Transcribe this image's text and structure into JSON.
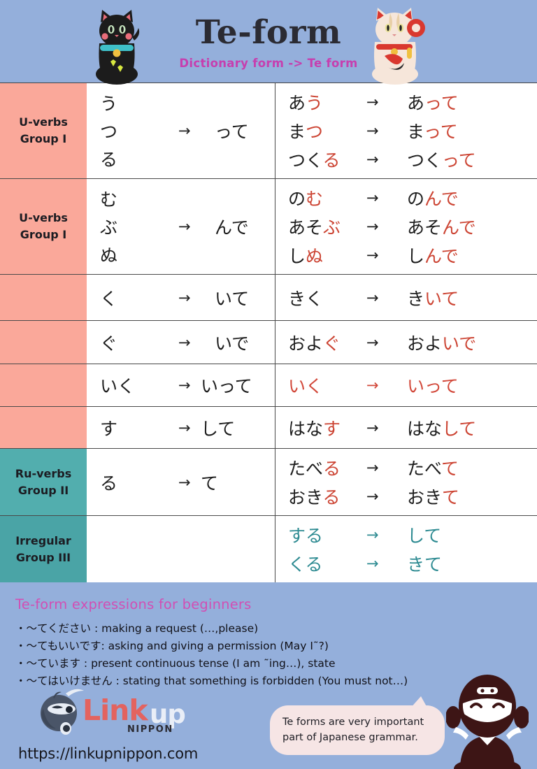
{
  "header": {
    "title": "Te-form",
    "subtitle": "Dictionary form  -> Te form",
    "cat_left": "black-maneki-neko",
    "cat_right": "white-maneki-neko"
  },
  "colors": {
    "background": "#94AFDB",
    "u_verbs_band": "#FAA89A",
    "ru_verbs_band": "#52AEAE",
    "irregular_band": "#4AA4A6",
    "highlight_red": "#CC4433",
    "irregular_teal": "#2E8B92",
    "title": "#2B2B33",
    "subtitle": "#C63FAF",
    "footer_heading": "#D14FB4"
  },
  "groups": {
    "u_verbs": {
      "line1": "U-verbs",
      "line2": "Group I"
    },
    "ru_verbs": {
      "line1": "Ru-verbs",
      "line2": "Group II"
    },
    "irregular": {
      "line1": "Irregular",
      "line2": "Group III"
    }
  },
  "arrow": "→",
  "rows": [
    {
      "rule": {
        "sources": [
          "う",
          "つ",
          "る"
        ],
        "arrow": "→",
        "result": "って"
      },
      "examples": [
        {
          "stem": "あ",
          "end": "う",
          "to": "あっ",
          "to_end": "って",
          "dict": "あう",
          "te": "あって"
        },
        {
          "stem": "ま",
          "end": "つ",
          "to": "まっ",
          "to_end": "って",
          "dict": "まつ",
          "te": "まって"
        },
        {
          "stem": "つく",
          "end": "る",
          "to": "つく",
          "to_end": "って",
          "dict": "つくる",
          "te": "つくって"
        }
      ]
    },
    {
      "rule": {
        "sources": [
          "む",
          "ぶ",
          "ぬ"
        ],
        "arrow": "→",
        "result": "んで"
      },
      "examples": [
        {
          "stem": "の",
          "end": "む",
          "to": "の",
          "to_end": "んで",
          "dict": "のむ",
          "te": "のんで"
        },
        {
          "stem": "あそ",
          "end": "ぶ",
          "to": "あそ",
          "to_end": "んで",
          "dict": "あそぶ",
          "te": "あそんで"
        },
        {
          "stem": "し",
          "end": "ぬ",
          "to": "し",
          "to_end": "んで",
          "dict": "しぬ",
          "te": "しんで"
        }
      ]
    },
    {
      "rule": {
        "sources": [
          "く"
        ],
        "arrow": "→",
        "result": "いて"
      },
      "examples": [
        {
          "stem": "き",
          "end": "く",
          "to": "き",
          "to_end": "いて",
          "dict": "きく",
          "te": "きいて"
        }
      ]
    },
    {
      "rule": {
        "sources": [
          "ぐ"
        ],
        "arrow": "→",
        "result": "いで"
      },
      "examples": [
        {
          "stem": "およ",
          "end": "ぐ",
          "to": "およ",
          "to_end": "いで",
          "dict": "およぐ",
          "te": "およいで"
        }
      ]
    },
    {
      "rule": {
        "sources": [
          "いく"
        ],
        "arrow": "→",
        "result": "いって"
      },
      "examples": [
        {
          "stem": "",
          "end": "いく",
          "to": "",
          "to_end": "いって",
          "dict": "いく",
          "te": "いって",
          "all_red": true
        }
      ]
    },
    {
      "rule": {
        "sources": [
          "す"
        ],
        "arrow": "→",
        "result": "して"
      },
      "examples": [
        {
          "stem": "はな",
          "end": "す",
          "to": "はな",
          "to_end": "して",
          "dict": "はなす",
          "te": "はなして"
        }
      ]
    }
  ],
  "ru_row": {
    "rule": {
      "sources": [
        "る"
      ],
      "arrow": "→",
      "result": "て"
    },
    "examples": [
      {
        "stem": "たべ",
        "end": "る",
        "to": "たべ",
        "to_end": "て",
        "dict": "たべる",
        "te": "たべて"
      },
      {
        "stem": "おき",
        "end": "る",
        "to": "おき",
        "to_end": "て",
        "dict": "おきる",
        "te": "おきて"
      }
    ]
  },
  "irregular_row": {
    "rule": {
      "sources": [],
      "arrow": "",
      "result": ""
    },
    "examples": [
      {
        "dict": "する",
        "te": "して"
      },
      {
        "dict": "くる",
        "te": "きて"
      }
    ]
  },
  "footer": {
    "heading": "Te-form expressions for beginners",
    "bullets": [
      "・〜てください : making a request (…,please)",
      "・〜てもいいです: asking and giving a permission (May I˜?)",
      "・〜ています : present continuous tense (I am ˜ing…), state",
      "・〜てはいけません : stating that something is forbidden (You must not…)"
    ]
  },
  "brand": {
    "logo_word": "Link",
    "logo_up": "up",
    "logo_nippon": "NIPPON",
    "url": "https://linkupnippon.com"
  },
  "bubble": {
    "line1": "Te forms are very important",
    "line2": "part of Japanese grammar."
  }
}
